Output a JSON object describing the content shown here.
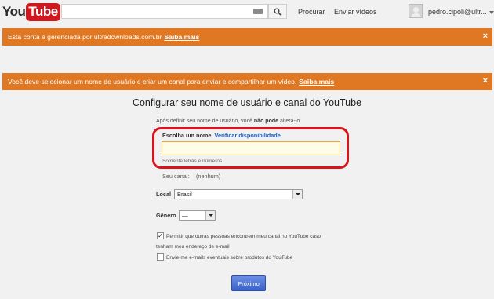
{
  "header": {
    "logo_you": "You",
    "logo_tube": "Tube",
    "search_placeholder": "",
    "link_search": "Procurar",
    "link_upload": "Enviar vídeos",
    "user": "pedro.cipoli@ultr..."
  },
  "notices": [
    {
      "text": "Esta conta é gerenciada por ultradownloads.com.br",
      "link": "Saiba mais",
      "close": "×"
    },
    {
      "text": "Você deve selecionar um nome de usuário e criar um canal para enviar e compartilhar um vídeo.",
      "link": "Saiba mais",
      "close": "×"
    }
  ],
  "form": {
    "title": "Configurar seu nome de usuário e canal do YouTube",
    "subtext_pre": "Após definir seu nome de usuário, você ",
    "subtext_bold": "não pode",
    "subtext_post": " alterá-lo.",
    "name_label": "Escolha um nome",
    "check_availability": "Verificar disponibilidade",
    "name_value": "",
    "hint": "Somente letras e números",
    "channel_label": "Seu canal:",
    "channel_value": "(nenhum)",
    "local_label": "Local",
    "local_value": "Brasil",
    "gender_label": "Gênero",
    "gender_value": "—",
    "checkbox1_line1": "Permitir que outras pessoas encontrem meu canal no YouTube caso",
    "checkbox1_line2": "tenham meu endereço de e-mail",
    "checkbox1_checked": true,
    "checkbox2_label": "Envie-me e-mails eventuais sobre produtos do YouTube",
    "checkbox2_checked": false,
    "next_button": "Próximo"
  },
  "colors": {
    "notice_bg": "#e07823",
    "highlight": "#d8141d",
    "logo_red": "#cc181e",
    "button_blue": "#3a62c7",
    "link_blue": "#1c5fc5"
  }
}
